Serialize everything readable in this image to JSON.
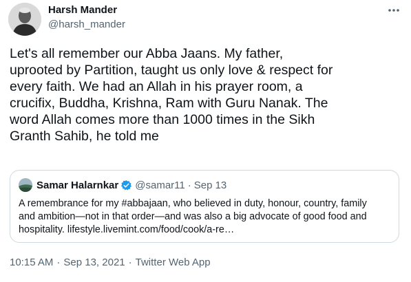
{
  "author": {
    "name": "Harsh Mander",
    "handle": "@harsh_mander"
  },
  "tweet": {
    "text": "Let's all remember our Abba Jaans. My father,\nuprooted by Partition, taught us only love & respect for\nevery faith. We had an Allah in his prayer room, a\ncrucifix, Buddha, Krishna, Ram with Guru Nanak. The\nword Allah comes more than 1000 times in the Sikh\nGranth Sahib, he told me"
  },
  "quoted_tweet": {
    "name": "Samar Halarnkar",
    "handle": "@samar11",
    "separator": "·",
    "date": "Sep 13",
    "text": "A remembrance for my #abbajaan, who believed in duty, honour, country, family\nand ambition—not in that order—and was also a big advocate of good food and\nhospitality. lifestyle.livemint.com/food/cook/a-re…"
  },
  "meta": {
    "time": "10:15 AM",
    "separator": "·",
    "date": "Sep 13, 2021",
    "source": "Twitter Web App"
  },
  "icons": {
    "more": "more-options-icon",
    "verified": "verified-badge-icon"
  },
  "colors": {
    "text": "#0f1419",
    "secondary": "#536471",
    "border": "#cfd9de",
    "verified": "#1d9bf0"
  }
}
